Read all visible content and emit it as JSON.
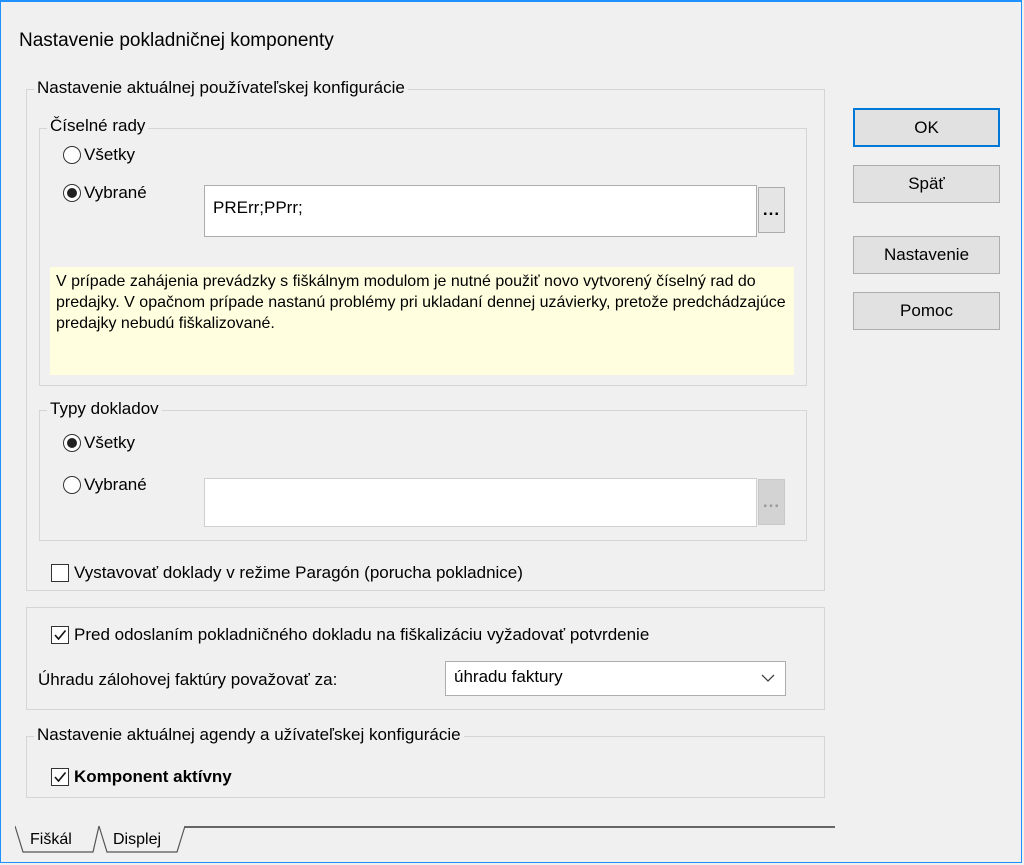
{
  "dialog": {
    "title": "Nastavenie pokladničnej komponenty"
  },
  "user_config": {
    "legend": "Nastavenie aktuálnej používateľskej konfigurácie",
    "number_series": {
      "legend": "Číselné rady",
      "option_all": "Všetky",
      "option_selected": "Vybrané",
      "selected_value": "all_or_selected:selected",
      "value": "PRErr;PPrr;",
      "browse_label": "..."
    },
    "info_text": "V prípade zahájenia prevádzky s fiškálnym modulom je nutné použiť novo vytvorený číselný rad do predajky. V opačnom prípade nastanú problémy pri ukladaní dennej uzávierky, pretože predchádzajúce predajky nebudú fiškalizované.",
    "doc_types": {
      "legend": "Typy dokladov",
      "option_all": "Všetky",
      "option_selected": "Vybrané",
      "value": "",
      "browse_label": "..."
    },
    "paragon_label": "Vystavovať doklady v režime Paragón (porucha pokladnice)",
    "paragon_checked": false
  },
  "fiscal": {
    "confirm_label": "Pred odoslaním pokladničného dokladu na fiškalizáciu vyžadovať potvrdenie",
    "confirm_checked": true,
    "advance_label": "Úhradu zálohovej faktúry považovať za:",
    "advance_value": "úhradu faktury"
  },
  "agenda": {
    "legend": "Nastavenie aktuálnej agendy a užívateľskej konfigurácie",
    "active_label": "Komponent aktívny",
    "active_checked": true
  },
  "buttons": {
    "ok": "OK",
    "back": "Späť",
    "settings": "Nastavenie",
    "help": "Pomoc"
  },
  "tabs": {
    "fiscal": "Fiškál",
    "display": "Displej"
  }
}
